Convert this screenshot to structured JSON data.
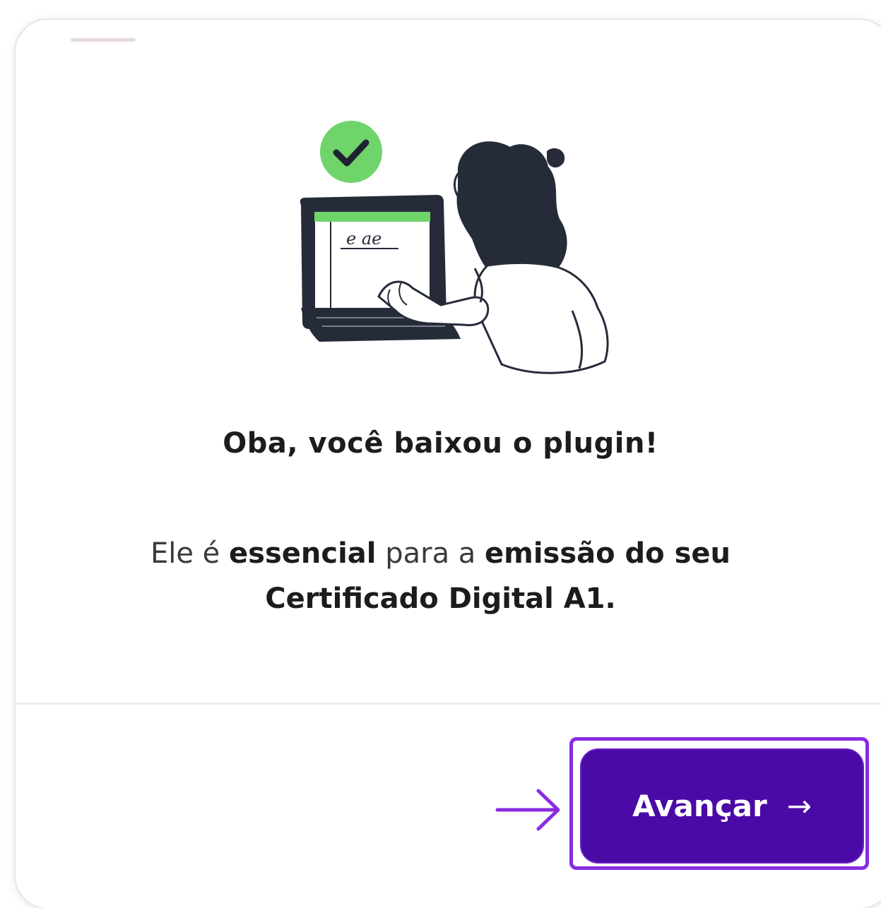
{
  "dialog": {
    "title": "Oba, você baixou o plugin!",
    "desc_part1": "Ele é ",
    "desc_bold1": "essencial",
    "desc_part2": " para a ",
    "desc_bold2": "emissão do seu",
    "desc_bold3": "Certificado Digital A1.",
    "illustration_text": "e ae"
  },
  "footer": {
    "next_label": "Avançar",
    "next_icon": "→"
  },
  "colors": {
    "button_bg": "#4a0aa6",
    "highlight": "#8a2be2",
    "check_green": "#6fd46a"
  }
}
